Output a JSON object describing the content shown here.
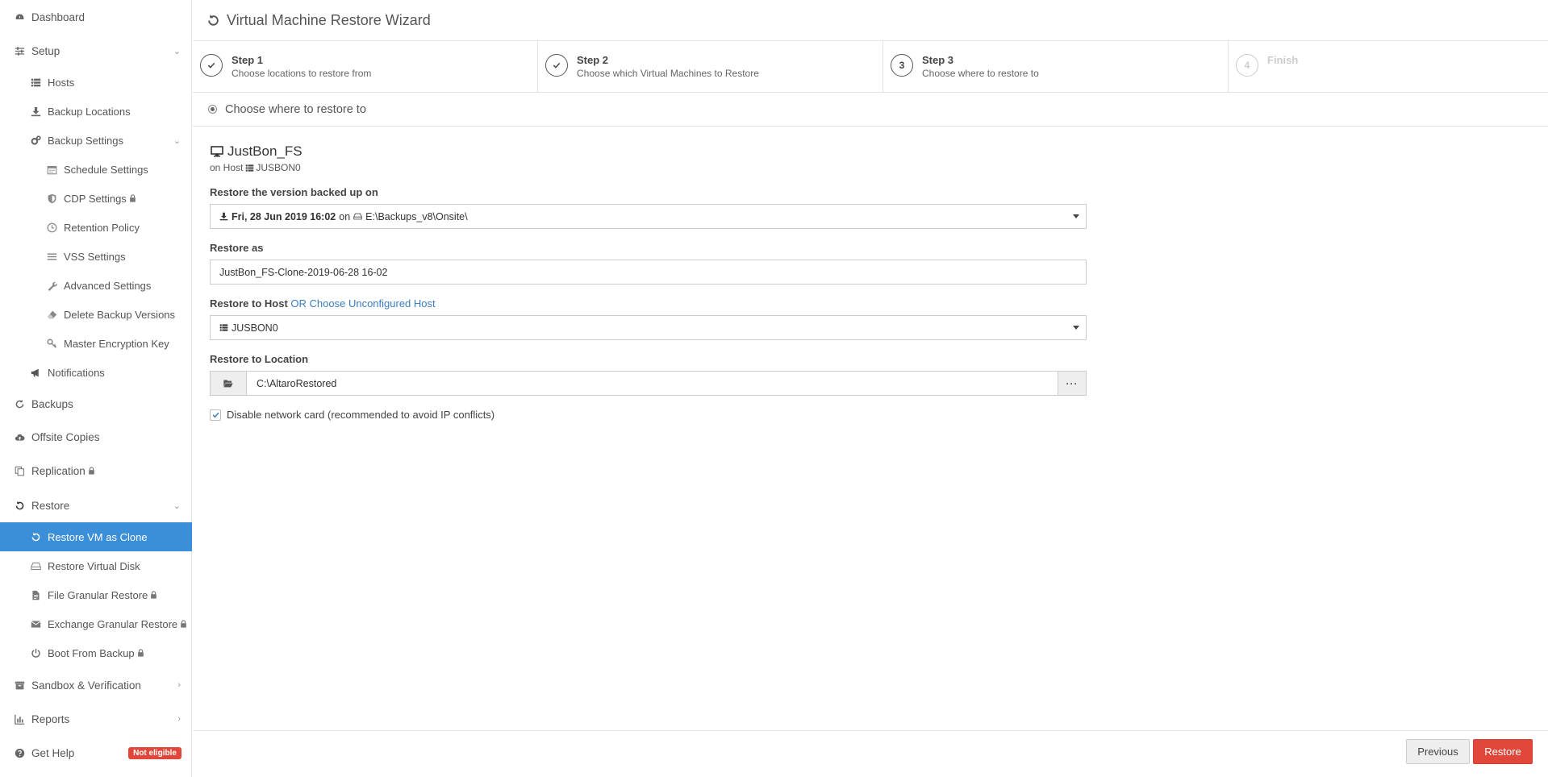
{
  "sidebar": {
    "dashboard": "Dashboard",
    "setup": "Setup",
    "hosts": "Hosts",
    "backup_locations": "Backup Locations",
    "backup_settings": "Backup Settings",
    "schedule_settings": "Schedule Settings",
    "cdp_settings": "CDP Settings",
    "retention_policy": "Retention Policy",
    "vss_settings": "VSS Settings",
    "advanced_settings": "Advanced Settings",
    "delete_backup_versions": "Delete Backup Versions",
    "master_encryption_key": "Master Encryption Key",
    "notifications": "Notifications",
    "backups": "Backups",
    "offsite_copies": "Offsite Copies",
    "replication": "Replication",
    "restore": "Restore",
    "restore_vm_as_clone": "Restore VM as Clone",
    "restore_virtual_disk": "Restore Virtual Disk",
    "file_granular_restore": "File Granular Restore",
    "exchange_granular_restore": "Exchange Granular Restore",
    "boot_from_backup": "Boot From Backup",
    "sandbox_verification": "Sandbox & Verification",
    "reports": "Reports",
    "get_help": "Get Help",
    "not_eligible": "Not eligible"
  },
  "header": {
    "title": "Virtual Machine Restore Wizard"
  },
  "steps": [
    {
      "title": "Step 1",
      "desc": "Choose locations to restore from",
      "state": "done"
    },
    {
      "title": "Step 2",
      "desc": "Choose which Virtual Machines to Restore",
      "state": "done"
    },
    {
      "title": "Step 3",
      "desc": "Choose where to restore to",
      "state": "current",
      "num": "3"
    },
    {
      "title": "Finish",
      "desc": "",
      "state": "disabled",
      "num": "4"
    }
  ],
  "section": {
    "title": "Choose where to restore to"
  },
  "vm": {
    "name": "JustBon_FS",
    "on_host_label": "on Host",
    "host": "JUSBON0"
  },
  "form": {
    "version_label": "Restore the version backed up on",
    "version_date": "Fri, 28 Jun 2019 16:02",
    "version_on": "on",
    "version_path": "E:\\Backups_v8\\Onsite\\",
    "restore_as_label": "Restore as",
    "restore_as_value": "JustBon_FS-Clone-2019-06-28 16-02",
    "restore_host_label": "Restore to Host",
    "unconfigured_link": "OR Choose Unconfigured Host",
    "restore_host_value": "JUSBON0",
    "location_label": "Restore to Location",
    "location_value": "C:\\AltaroRestored",
    "browse_label": "···",
    "disable_nic_label": "Disable network card (recommended to avoid IP conflicts)",
    "disable_nic_checked": true
  },
  "footer": {
    "previous": "Previous",
    "restore": "Restore"
  },
  "colors": {
    "accent": "#3b8ed8",
    "danger": "#e0473a"
  }
}
